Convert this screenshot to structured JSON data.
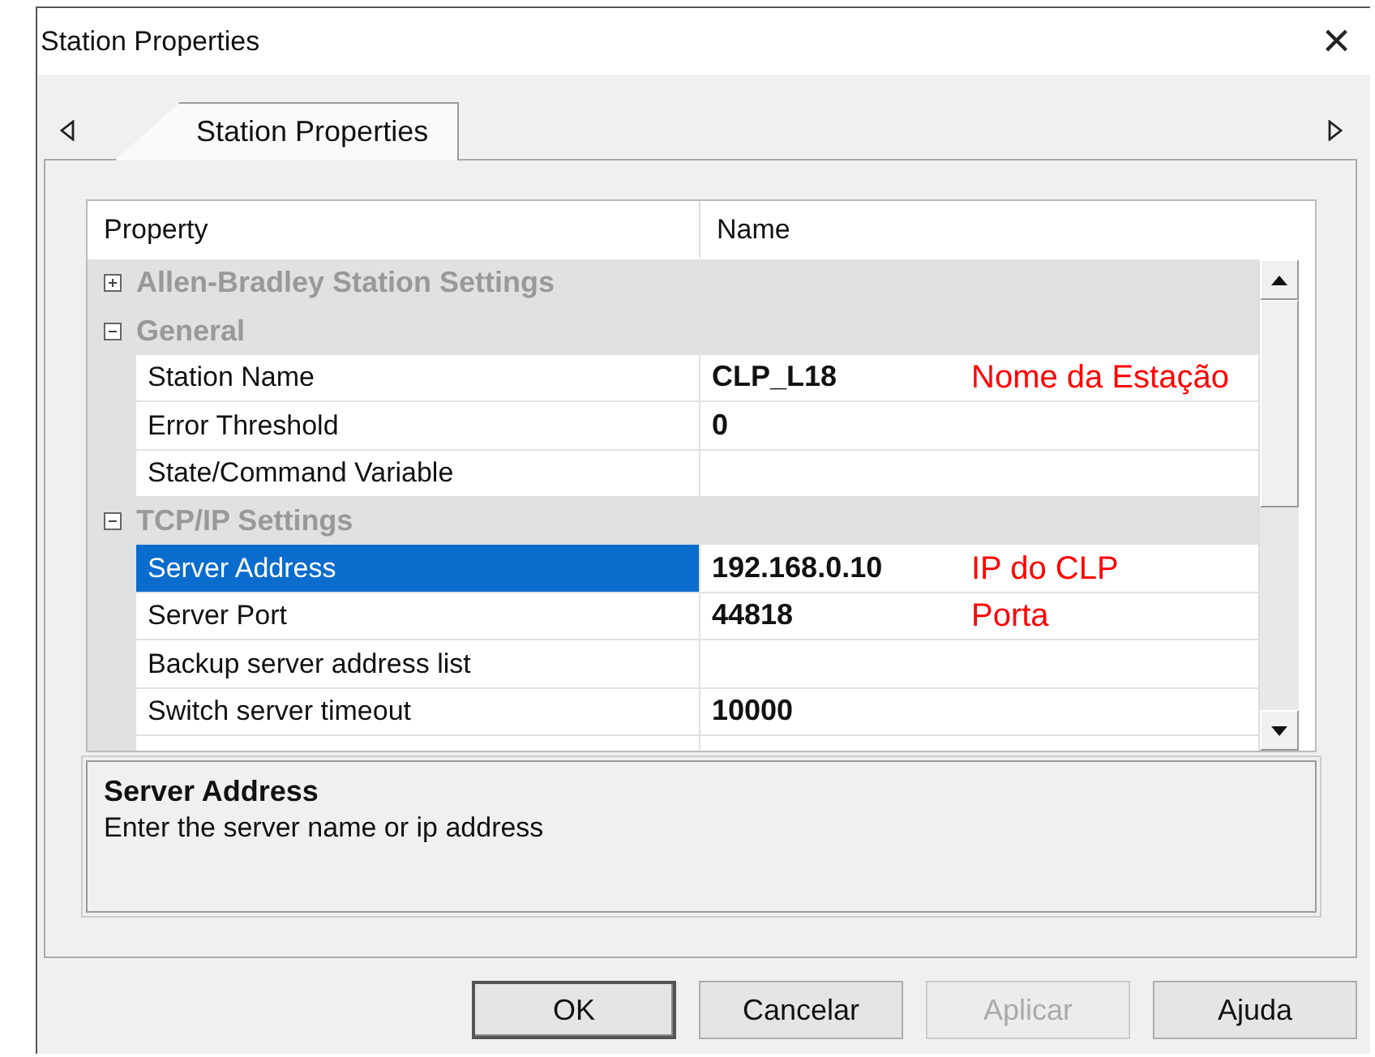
{
  "window": {
    "title": "Station Properties",
    "close": "×"
  },
  "tabs": [
    {
      "label": "Station Properties",
      "selected": true
    }
  ],
  "grid": {
    "columns": [
      "Property",
      "Name"
    ],
    "rows": [
      {
        "kind": "category",
        "label": "Allen-Bradley Station Settings",
        "expanded": false
      },
      {
        "kind": "category",
        "label": "General",
        "expanded": true
      },
      {
        "kind": "property",
        "label": "Station Name",
        "value": "CLP_L18",
        "selected": false,
        "annotation": "Nome da Estação"
      },
      {
        "kind": "property",
        "label": "Error Threshold",
        "value": "0",
        "selected": false
      },
      {
        "kind": "property",
        "label": "State/Command Variable",
        "selected": false
      },
      {
        "kind": "category",
        "label": "TCP/IP Settings",
        "expanded": true
      },
      {
        "kind": "property",
        "label": "Server Address",
        "value": "192.168.0.10",
        "selected": true,
        "annotation": "IP do CLP"
      },
      {
        "kind": "property",
        "label": "Server Port",
        "value": "44818",
        "selected": false,
        "annotation": "Porta"
      },
      {
        "kind": "property",
        "label": "Backup server address list",
        "selected": false
      },
      {
        "kind": "property",
        "label": "Switch server timeout",
        "value": "10000",
        "selected": false
      }
    ]
  },
  "help": {
    "title": "Server Address",
    "text": "Enter the server name or ip address"
  },
  "buttons": [
    {
      "label": "OK",
      "default": true,
      "disabled": false
    },
    {
      "label": "Cancelar",
      "default": false,
      "disabled": false
    },
    {
      "label": "Aplicar",
      "default": false,
      "disabled": true
    },
    {
      "label": "Ajuda",
      "default": false,
      "disabled": false
    }
  ]
}
